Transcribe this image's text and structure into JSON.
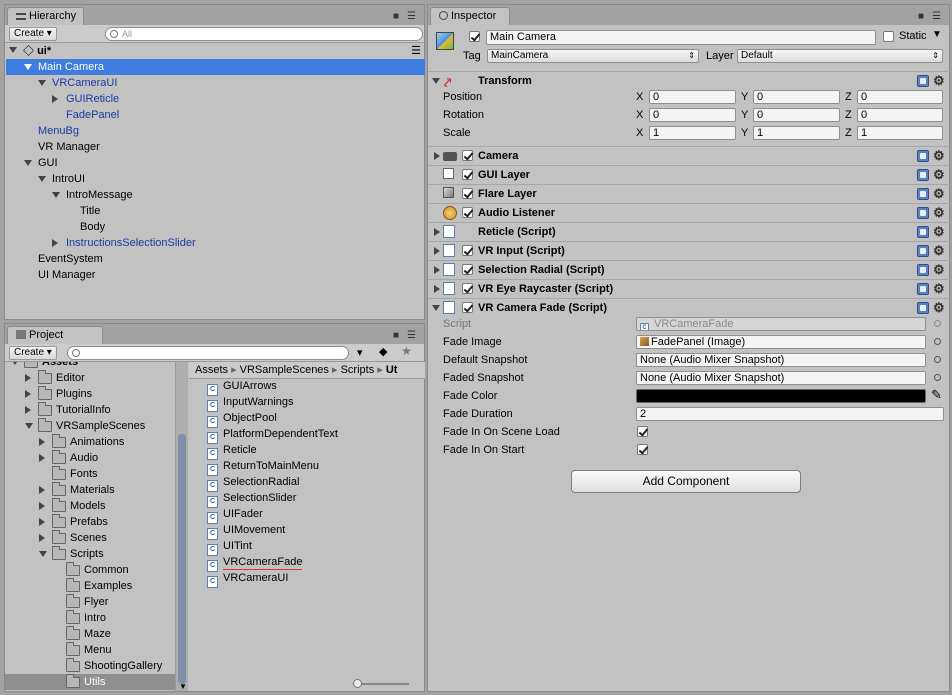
{
  "hierarchy": {
    "tab": "Hierarchy",
    "create_label": "Create",
    "search_placeholder": "All",
    "scene": "ui*",
    "items": [
      {
        "label": "Main Camera",
        "indent": 0,
        "arrow": "down",
        "selected": true,
        "prefab": false
      },
      {
        "label": "VRCameraUI",
        "indent": 1,
        "arrow": "down",
        "selected": false,
        "prefab": true
      },
      {
        "label": "GUIReticle",
        "indent": 2,
        "arrow": "right",
        "selected": false,
        "prefab": true
      },
      {
        "label": "FadePanel",
        "indent": 2,
        "arrow": "",
        "selected": false,
        "prefab": true
      },
      {
        "label": "MenuBg",
        "indent": 0,
        "arrow": "",
        "selected": false,
        "prefab": true
      },
      {
        "label": "VR Manager",
        "indent": 0,
        "arrow": "",
        "selected": false,
        "prefab": false
      },
      {
        "label": "GUI",
        "indent": 0,
        "arrow": "down",
        "selected": false,
        "prefab": false
      },
      {
        "label": "IntroUI",
        "indent": 1,
        "arrow": "down",
        "selected": false,
        "prefab": false
      },
      {
        "label": "IntroMessage",
        "indent": 2,
        "arrow": "down",
        "selected": false,
        "prefab": false
      },
      {
        "label": "Title",
        "indent": 3,
        "arrow": "",
        "selected": false,
        "prefab": false
      },
      {
        "label": "Body",
        "indent": 3,
        "arrow": "",
        "selected": false,
        "prefab": false
      },
      {
        "label": "InstructionsSelectionSlider",
        "indent": 2,
        "arrow": "right",
        "selected": false,
        "prefab": true
      },
      {
        "label": "EventSystem",
        "indent": 0,
        "arrow": "",
        "selected": false,
        "prefab": false
      },
      {
        "label": "UI Manager",
        "indent": 0,
        "arrow": "",
        "selected": false,
        "prefab": false
      }
    ]
  },
  "project": {
    "tab": "Project",
    "create_label": "Create",
    "tree": [
      {
        "label": "Assets",
        "indent": 0,
        "arrow": "down",
        "selected": false,
        "bold": true
      },
      {
        "label": "Editor",
        "indent": 1,
        "arrow": "right",
        "selected": false
      },
      {
        "label": "Plugins",
        "indent": 1,
        "arrow": "right",
        "selected": false
      },
      {
        "label": "TutorialInfo",
        "indent": 1,
        "arrow": "right",
        "selected": false
      },
      {
        "label": "VRSampleScenes",
        "indent": 1,
        "arrow": "down",
        "selected": false
      },
      {
        "label": "Animations",
        "indent": 2,
        "arrow": "right",
        "selected": false
      },
      {
        "label": "Audio",
        "indent": 2,
        "arrow": "right",
        "selected": false
      },
      {
        "label": "Fonts",
        "indent": 2,
        "arrow": "",
        "selected": false
      },
      {
        "label": "Materials",
        "indent": 2,
        "arrow": "right",
        "selected": false
      },
      {
        "label": "Models",
        "indent": 2,
        "arrow": "right",
        "selected": false
      },
      {
        "label": "Prefabs",
        "indent": 2,
        "arrow": "right",
        "selected": false
      },
      {
        "label": "Scenes",
        "indent": 2,
        "arrow": "right",
        "selected": false
      },
      {
        "label": "Scripts",
        "indent": 2,
        "arrow": "down",
        "selected": false
      },
      {
        "label": "Common",
        "indent": 3,
        "arrow": "",
        "selected": false
      },
      {
        "label": "Examples",
        "indent": 3,
        "arrow": "",
        "selected": false
      },
      {
        "label": "Flyer",
        "indent": 3,
        "arrow": "",
        "selected": false
      },
      {
        "label": "Intro",
        "indent": 3,
        "arrow": "",
        "selected": false
      },
      {
        "label": "Maze",
        "indent": 3,
        "arrow": "",
        "selected": false
      },
      {
        "label": "Menu",
        "indent": 3,
        "arrow": "",
        "selected": false
      },
      {
        "label": "ShootingGallery",
        "indent": 3,
        "arrow": "",
        "selected": false
      },
      {
        "label": "Utils",
        "indent": 3,
        "arrow": "",
        "selected": true
      }
    ],
    "breadcrumb": [
      "Assets",
      "VRSampleScenes",
      "Scripts",
      "Ut"
    ],
    "files": [
      "GUIArrows",
      "InputWarnings",
      "ObjectPool",
      "PlatformDependentText",
      "Reticle",
      "ReturnToMainMenu",
      "SelectionRadial",
      "SelectionSlider",
      "UIFader",
      "UIMovement",
      "UITint",
      "VRCameraFade",
      "VRCameraUI"
    ]
  },
  "inspector": {
    "tab": "Inspector",
    "object_name": "Main Camera",
    "static_label": "Static",
    "tag_label": "Tag",
    "tag_value": "MainCamera",
    "layer_label": "Layer",
    "layer_value": "Default",
    "transform": {
      "title": "Transform",
      "rows": [
        {
          "label": "Position",
          "x": "0",
          "y": "0",
          "z": "0"
        },
        {
          "label": "Rotation",
          "x": "0",
          "y": "0",
          "z": "0"
        },
        {
          "label": "Scale",
          "x": "1",
          "y": "1",
          "z": "1"
        }
      ],
      "axis_x": "X",
      "axis_y": "Y",
      "axis_z": "Z"
    },
    "components": [
      {
        "label": "Camera",
        "arrow": true,
        "check": true,
        "icon": "camera-icon"
      },
      {
        "label": "GUI Layer",
        "arrow": false,
        "check": true,
        "icon": "gui-layer-icon"
      },
      {
        "label": "Flare Layer",
        "arrow": false,
        "check": true,
        "icon": "flare-layer-icon"
      },
      {
        "label": "Audio Listener",
        "arrow": false,
        "check": true,
        "icon": "audio-listener-icon"
      },
      {
        "label": "Reticle (Script)",
        "arrow": true,
        "check": false,
        "icon": "script-icon"
      },
      {
        "label": "VR Input (Script)",
        "arrow": true,
        "check": true,
        "icon": "script-icon"
      },
      {
        "label": "Selection Radial (Script)",
        "arrow": true,
        "check": true,
        "icon": "script-icon"
      },
      {
        "label": "VR Eye Raycaster (Script)",
        "arrow": true,
        "check": true,
        "icon": "script-icon"
      },
      {
        "label": "VR Camera Fade (Script)",
        "arrow": true,
        "check": true,
        "icon": "script-icon",
        "expanded": true
      }
    ],
    "fade": {
      "script_label": "Script",
      "script_value": "VRCameraFade",
      "fade_image_label": "Fade Image",
      "fade_image_value": "FadePanel (Image)",
      "default_snapshot_label": "Default Snapshot",
      "default_snapshot_value": "None (Audio Mixer Snapshot)",
      "faded_snapshot_label": "Faded Snapshot",
      "faded_snapshot_value": "None (Audio Mixer Snapshot)",
      "fade_color_label": "Fade Color",
      "fade_color_value": "#000000",
      "fade_duration_label": "Fade Duration",
      "fade_duration_value": "2",
      "fade_in_load_label": "Fade In On Scene Load",
      "fade_in_load_checked": true,
      "fade_in_start_label": "Fade In On Start",
      "fade_in_start_checked": true
    },
    "add_component_label": "Add Component"
  }
}
